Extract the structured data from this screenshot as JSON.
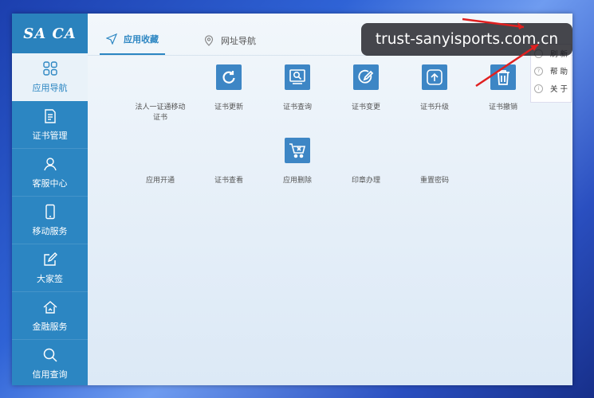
{
  "logo": {
    "text": "SA CA"
  },
  "sidebar": {
    "items": [
      {
        "label": "应用导航",
        "icon": "grid-icon",
        "active": true
      },
      {
        "label": "证书管理",
        "icon": "document-icon"
      },
      {
        "label": "客服中心",
        "icon": "person-icon"
      },
      {
        "label": "移动服务",
        "icon": "mobile-icon"
      },
      {
        "label": "大家签",
        "icon": "edit-icon"
      },
      {
        "label": "金融服务",
        "icon": "home-icon"
      },
      {
        "label": "信用查询",
        "icon": "search-icon"
      }
    ]
  },
  "tabs": [
    {
      "label": "应用收藏",
      "icon": "send-icon",
      "active": true
    },
    {
      "label": "网址导航",
      "icon": "location-icon"
    }
  ],
  "apps_row1": [
    {
      "label": "法人一证通移动证书",
      "icon": ""
    },
    {
      "label": "证书更新",
      "icon": "refresh-icon"
    },
    {
      "label": "证书查询",
      "icon": "search-doc-icon"
    },
    {
      "label": "证书变更",
      "icon": "edit-circle-icon"
    },
    {
      "label": "证书升级",
      "icon": "upgrade-icon"
    },
    {
      "label": "证书撤销",
      "icon": "trash-icon"
    }
  ],
  "apps_row2": [
    {
      "label": "应用开通",
      "icon": ""
    },
    {
      "label": "证书查看",
      "icon": ""
    },
    {
      "label": "应用删除",
      "icon": "cart-delete-icon"
    },
    {
      "label": "印章办理",
      "icon": ""
    },
    {
      "label": "重置密码",
      "icon": ""
    }
  ],
  "menu": {
    "items": [
      {
        "label": "刷 新"
      },
      {
        "label": "帮 助"
      },
      {
        "label": "关 于"
      }
    ]
  },
  "watermark": {
    "text": "trust-sanyisports.com.cn"
  },
  "colors": {
    "sidebar": "#2c86c2",
    "accent": "#3d86c5",
    "arrow": "#e02020"
  }
}
